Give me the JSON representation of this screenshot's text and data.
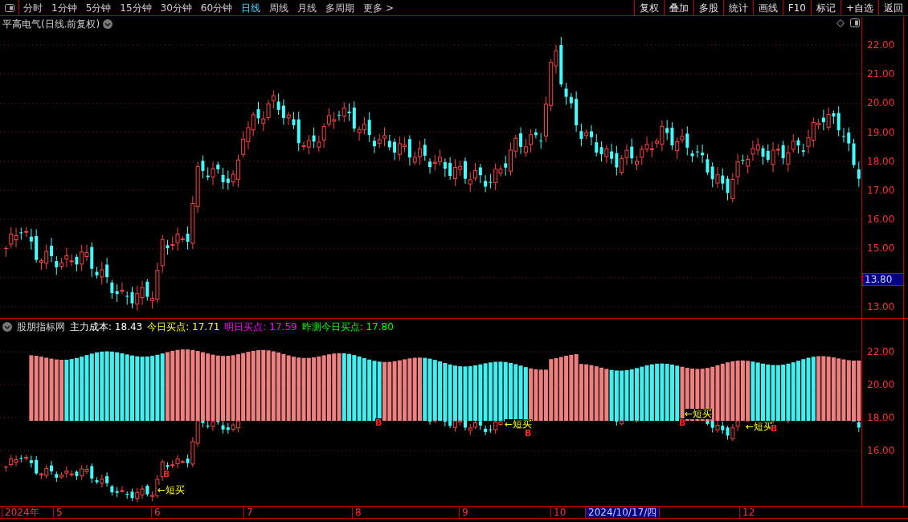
{
  "toolbar": {
    "periods": [
      {
        "label": "分时",
        "selected": false
      },
      {
        "label": "1分钟",
        "selected": false
      },
      {
        "label": "5分钟",
        "selected": false
      },
      {
        "label": "15分钟",
        "selected": false
      },
      {
        "label": "30分钟",
        "selected": false
      },
      {
        "label": "60分钟",
        "selected": false
      },
      {
        "label": "日线",
        "selected": true
      },
      {
        "label": "周线",
        "selected": false
      },
      {
        "label": "月线",
        "selected": false
      },
      {
        "label": "多周期",
        "selected": false
      },
      {
        "label": "更多 >",
        "selected": false
      }
    ],
    "buttons": [
      "复权",
      "叠加",
      "多股",
      "统计",
      "画线",
      "F10",
      "标记",
      "+自选",
      "返回"
    ]
  },
  "price_pane": {
    "title": "平高电气(日线.前复权)",
    "y_ticks": [
      "22.00",
      "21.00",
      "20.00",
      "19.00",
      "18.00",
      "17.00",
      "16.00",
      "15.00",
      "13.00"
    ],
    "cursor_price": "13.80"
  },
  "indicator_pane": {
    "name": "股朋指标网",
    "legend": [
      {
        "label": "主力成本:",
        "value": "18.43",
        "color": "#ffffff"
      },
      {
        "label": "今日买点:",
        "value": "17.71",
        "color": "#ffff00"
      },
      {
        "label": "明日买点:",
        "value": "17.59",
        "color": "#ff00ff"
      },
      {
        "label": "昨测今日买点:",
        "value": "17.80",
        "color": "#00ff00"
      }
    ],
    "signals": [
      {
        "label": "←短买"
      },
      {
        "label": "←短买"
      },
      {
        "label": "←短买"
      },
      {
        "label": "←短买"
      }
    ],
    "markers": [
      {
        "label": "B"
      },
      {
        "label": "B"
      },
      {
        "label": "B"
      },
      {
        "label": "B"
      },
      {
        "label": "B"
      }
    ],
    "y_ticks": [
      "22.00",
      "20.00",
      "18.00",
      "16.00"
    ]
  },
  "time_axis": {
    "labels": [
      {
        "label": "2024年",
        "selected": false
      },
      {
        "label": "5",
        "selected": false
      },
      {
        "label": "6",
        "selected": false
      },
      {
        "label": "7",
        "selected": false
      },
      {
        "label": "8",
        "selected": false
      },
      {
        "label": "9",
        "selected": false
      },
      {
        "label": "10",
        "selected": false
      },
      {
        "label": "2024/10/17/四",
        "selected": true
      },
      {
        "label": "12",
        "selected": false
      }
    ]
  }
}
